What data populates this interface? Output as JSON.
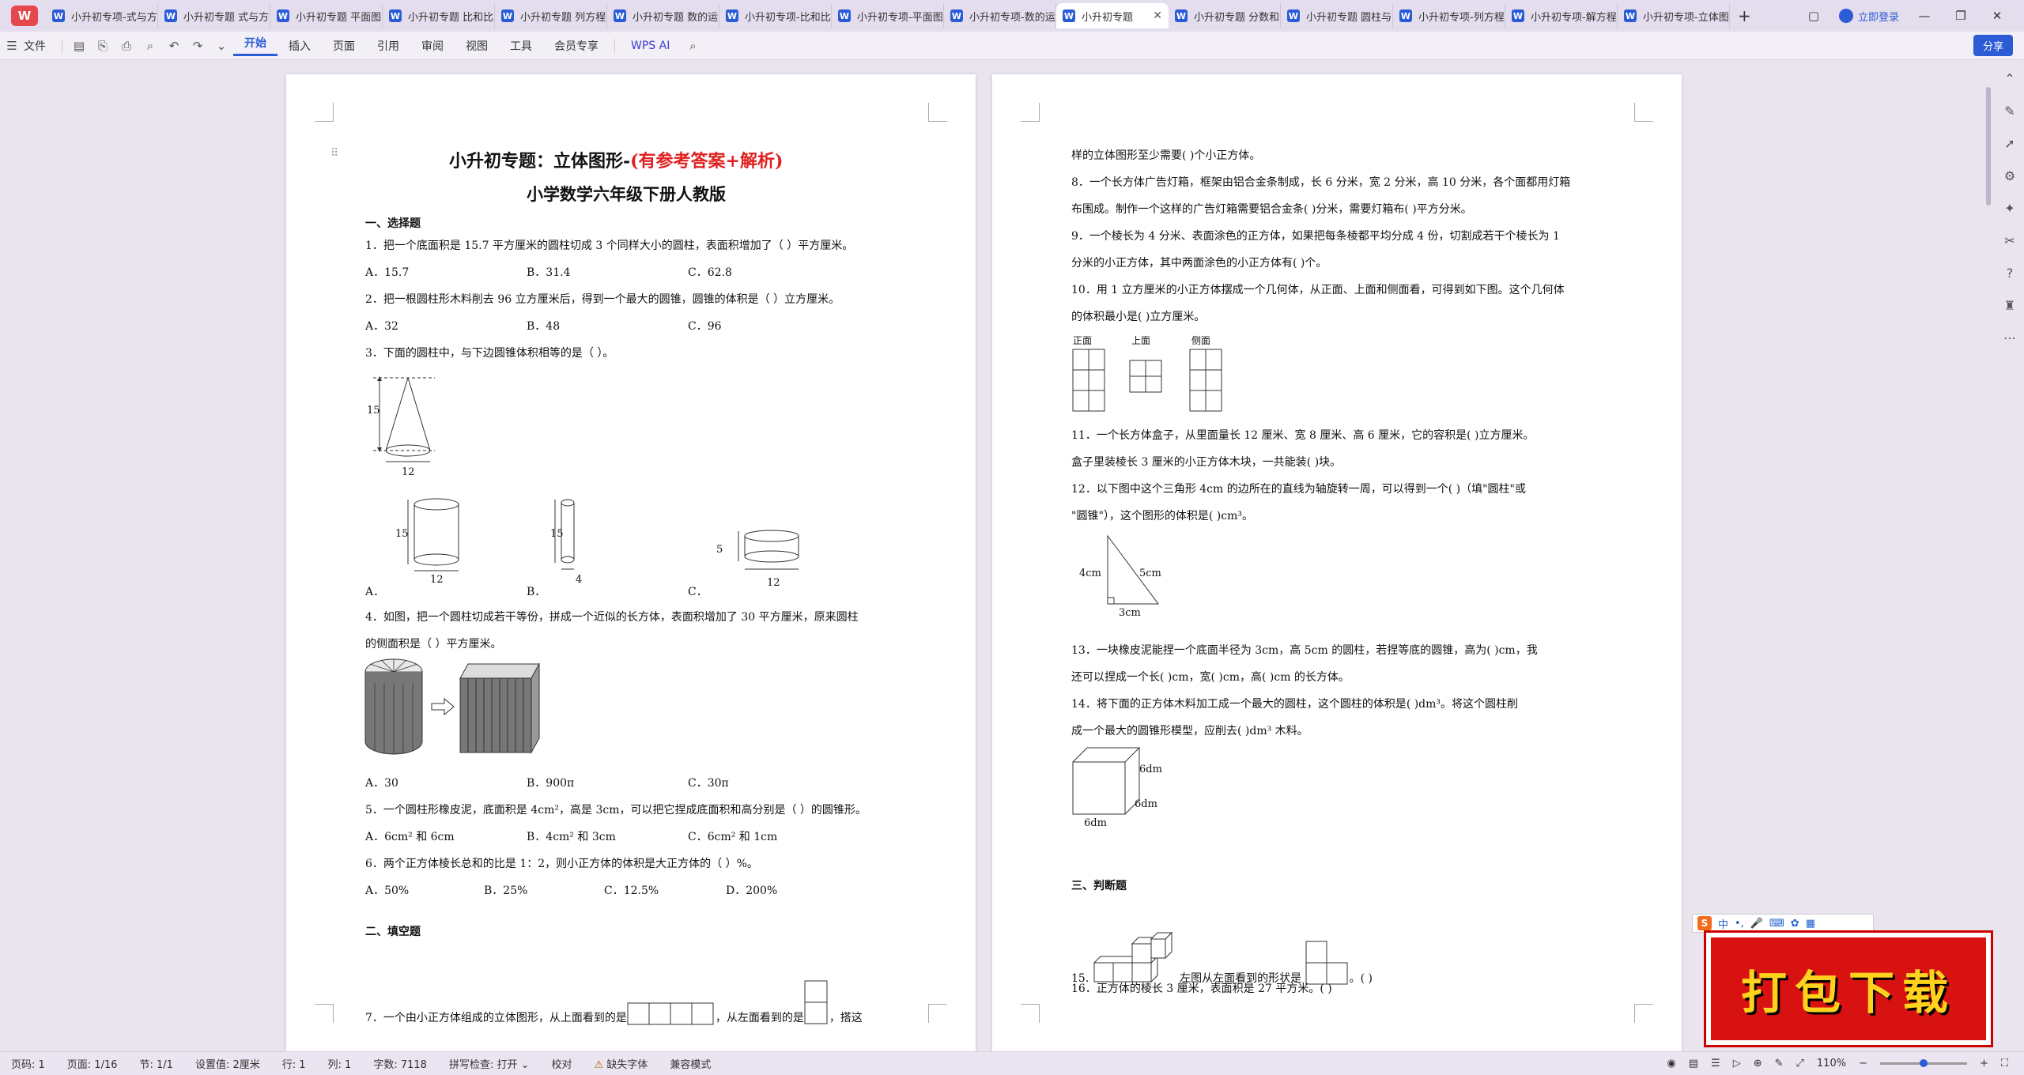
{
  "tabs": [
    {
      "label": "小升初专项-式与方"
    },
    {
      "label": "小升初专题 式与方"
    },
    {
      "label": "小升初专题 平面图"
    },
    {
      "label": "小升初专题 比和比"
    },
    {
      "label": "小升初专题 列方程"
    },
    {
      "label": "小升初专题 数的运"
    },
    {
      "label": "小升初专项-比和比"
    },
    {
      "label": "小升初专项-平面图"
    },
    {
      "label": "小升初专项-数的运"
    },
    {
      "label": "小升初专题"
    },
    {
      "label": "小升初专题 分数和"
    },
    {
      "label": "小升初专题 圆柱与"
    },
    {
      "label": "小升初专项-列方程"
    },
    {
      "label": "小升初专项-解方程"
    },
    {
      "label": "小升初专项-立体图"
    }
  ],
  "header": {
    "login_label": "立即登录"
  },
  "ribbon": {
    "file_label": "文件",
    "items": [
      "开始",
      "插入",
      "页面",
      "引用",
      "审阅",
      "视图",
      "工具",
      "会员专享"
    ],
    "wps_ai_label": "WPS AI",
    "share_label": "分享"
  },
  "page1": {
    "title_black": "小升初专题：立体图形-",
    "title_red": "(有参考答案+解析)",
    "subtitle": "小学数学六年级下册人教版",
    "sec1": "一、选择题",
    "q1": "1．把一个底面积是 15.7 平方厘米的圆柱切成 3 个同样大小的圆柱，表面积增加了（    ）平方厘米。",
    "q1_opts": [
      "A．15.7",
      "B．31.4",
      "C．62.8"
    ],
    "q2": "2．把一根圆柱形木料削去 96 立方厘米后，得到一个最大的圆锥，圆锥的体积是（    ）立方厘米。",
    "q2_opts": [
      "A．32",
      "B．48",
      "C．96"
    ],
    "q3": "3．下面的圆柱中，与下边圆锥体积相等的是（    ）。",
    "q3_cone_h": "15",
    "q3_cone_d": "12",
    "q3_opts": [
      "A．",
      "B．",
      "C．"
    ],
    "q3_a_h": "15",
    "q3_a_d": "12",
    "q3_b_h": "15",
    "q3_b_d": "4",
    "q3_c_h": "5",
    "q3_c_d": "12",
    "q4_l1": "4．如图，把一个圆柱切成若干等份，拼成一个近似的长方体，表面积增加了 30 平方厘米，原来圆柱",
    "q4_l2": "的侧面积是（    ）平方厘米。",
    "q4_opts": [
      "A．30",
      "B．900π",
      "C．30π"
    ],
    "q5": "5．一个圆柱形橡皮泥，底面积是 4cm²，高是 3cm，可以把它捏成底面积和高分别是（    ）的圆锥形。",
    "q5_opts": [
      "A．6cm² 和 6cm",
      "B．4cm² 和 3cm",
      "C．6cm² 和 1cm"
    ],
    "q6": "6．两个正方体棱长总和的比是 1：2，则小正方体的体积是大正方体的（    ）%。",
    "q6_opts": [
      "A．50%",
      "B．25%",
      "C．12.5%",
      "D．200%"
    ],
    "sec2": "二、填空题",
    "q7_a": "7．一个由小正方体组成的立体图形，从上面看到的是",
    "q7_b": "，从左面看到的是",
    "q7_c": "，搭这"
  },
  "page2": {
    "q7_end": "样的立体图形至少需要(            )个小正方体。",
    "q8_l1": "8．一个长方体广告灯箱，框架由铝合金条制成，长 6 分米，宽 2 分米，高 10 分米，各个面都用灯箱",
    "q8_l2": "布围成。制作一个这样的广告灯箱需要铝合金条(            )分米，需要灯箱布(            )平方分米。",
    "q9_l1": "9．一个棱长为 4 分米、表面涂色的正方体，如果把每条棱都平均分成 4 份，切割成若干个棱长为 1",
    "q9_l2": "分米的小正方体，其中两面涂色的小正方体有(            )个。",
    "q10_l1": "10．用 1 立方厘米的小正方体摆成一个几何体，从正面、上面和侧面看，可得到如下图。这个几何体",
    "q10_l2": "的体积最小是(            )立方厘米。",
    "q10_labels": [
      "正面",
      "上面",
      "侧面"
    ],
    "q11_l1": "11．一个长方体盒子，从里面量长 12 厘米、宽 8 厘米、高 6 厘米，它的容积是(            )立方厘米。",
    "q11_l2": "盒子里装棱长 3 厘米的小正方体木块，一共能装(            )块。",
    "q12_l1": "12．以下图中这个三角形 4cm 的边所在的直线为轴旋转一周，可以得到一个(            )（填\"圆柱\"或",
    "q12_l2": "\"圆锥\"），这个图形的体积是(            )cm³。",
    "q12_left": "4cm",
    "q12_hyp": "5cm",
    "q12_bottom": "3cm",
    "q13_l1": "13．一块橡皮泥能捏一个底面半径为 3cm，高 5cm 的圆柱，若捏等底的圆锥，高为(            )cm，我",
    "q13_l2": "还可以捏成一个长(            )cm，宽(            )cm，高(            )cm 的长方体。",
    "q14_l1": "14．将下面的正方体木料加工成一个最大的圆柱，这个圆柱的体积是(            )dm³。将这个圆柱削",
    "q14_l2": "成一个最大的圆锥形模型，应削去(            )dm³ 木料。",
    "q14_dims": [
      "6dm",
      "6dm",
      "6dm"
    ],
    "sec3": "三、判断题",
    "q15_a": "15.",
    "q15_b": "左图从左面看到的形状是",
    "q15_c": "。(            )",
    "q16": "16．正方体的棱长 3 厘米，表面积是 27 平方米。(            )"
  },
  "status": {
    "page_num": "页码: 1",
    "page_count": "页面: 1/16",
    "section": "节: 1/1",
    "setting": "设置值: 2厘米",
    "row": "行: 1",
    "col": "列: 1",
    "words": "字数: 7118",
    "spell": "拼写检查: 打开",
    "proof": "校对",
    "missing_font": "缺失字体",
    "compat": "兼容模式",
    "zoom": "110%"
  },
  "ime": {
    "lang": "中"
  },
  "banner": {
    "text": "打包下载"
  }
}
